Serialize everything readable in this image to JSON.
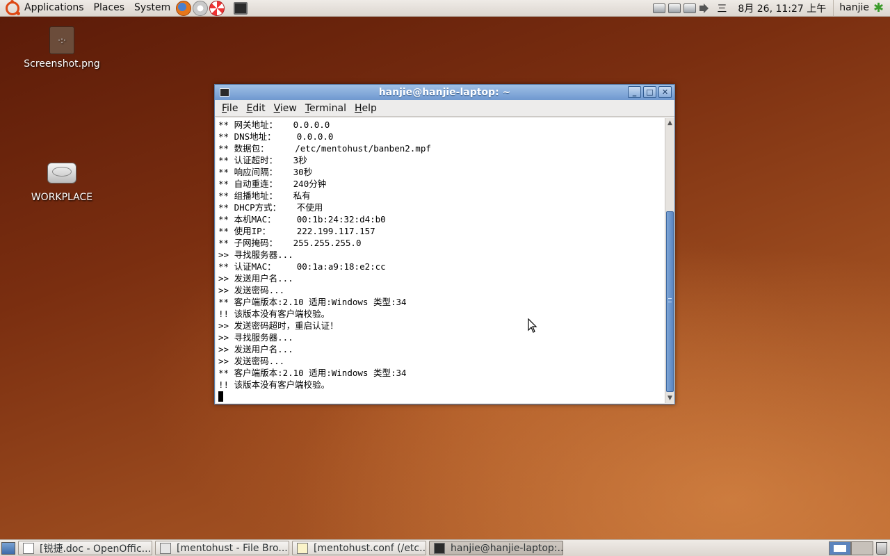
{
  "top_panel": {
    "menus": [
      "Applications",
      "Places",
      "System"
    ],
    "tray_text": "三",
    "clock": "8月 26, 11:27 上午",
    "user": "hanjie"
  },
  "desktop_icons": [
    {
      "label": "Screenshot.png",
      "icon": "image-file-icon"
    },
    {
      "label": "WORKPLACE",
      "icon": "drive-icon"
    }
  ],
  "terminal": {
    "title": "hanjie@hanjie-laptop: ~",
    "menu": [
      "File",
      "Edit",
      "View",
      "Terminal",
      "Help"
    ],
    "lines": [
      "** 网关地址：   0.0.0.0",
      "** DNS地址：    0.0.0.0",
      "** 数据包：     /etc/mentohust/banben2.mpf",
      "** 认证超时：   3秒",
      "** 响应间隔：   30秒",
      "** 自动重连：   240分钟",
      "** 组播地址：   私有",
      "** DHCP方式：   不使用",
      "** 本机MAC：    00:1b:24:32:d4:b0",
      "** 使用IP：     222.199.117.157",
      "** 子网掩码：   255.255.255.0",
      ">> 寻找服务器...",
      "** 认证MAC：    00:1a:a9:18:e2:cc",
      ">> 发送用户名...",
      ">> 发送密码...",
      "** 客户端版本:2.10 适用:Windows 类型:34",
      "!! 该版本没有客户端校验。",
      ">> 发送密码超时，重启认证！",
      ">> 寻找服务器...",
      ">> 发送用户名...",
      ">> 发送密码...",
      "** 客户端版本:2.10 适用:Windows 类型:34",
      "!! 该版本没有客户端校验。"
    ]
  },
  "taskbar": {
    "tasks": [
      {
        "label": "[锐捷.doc - OpenOffic...",
        "icon": "document-icon"
      },
      {
        "label": "[mentohust - File Bro...",
        "icon": "folder-icon"
      },
      {
        "label": "[mentohust.conf (/etc...",
        "icon": "text-editor-icon"
      },
      {
        "label": "hanjie@hanjie-laptop:...",
        "icon": "terminal-icon"
      }
    ]
  },
  "colors": {
    "title_bar": "#7fa6d6",
    "desktop": "#8a3c16"
  }
}
